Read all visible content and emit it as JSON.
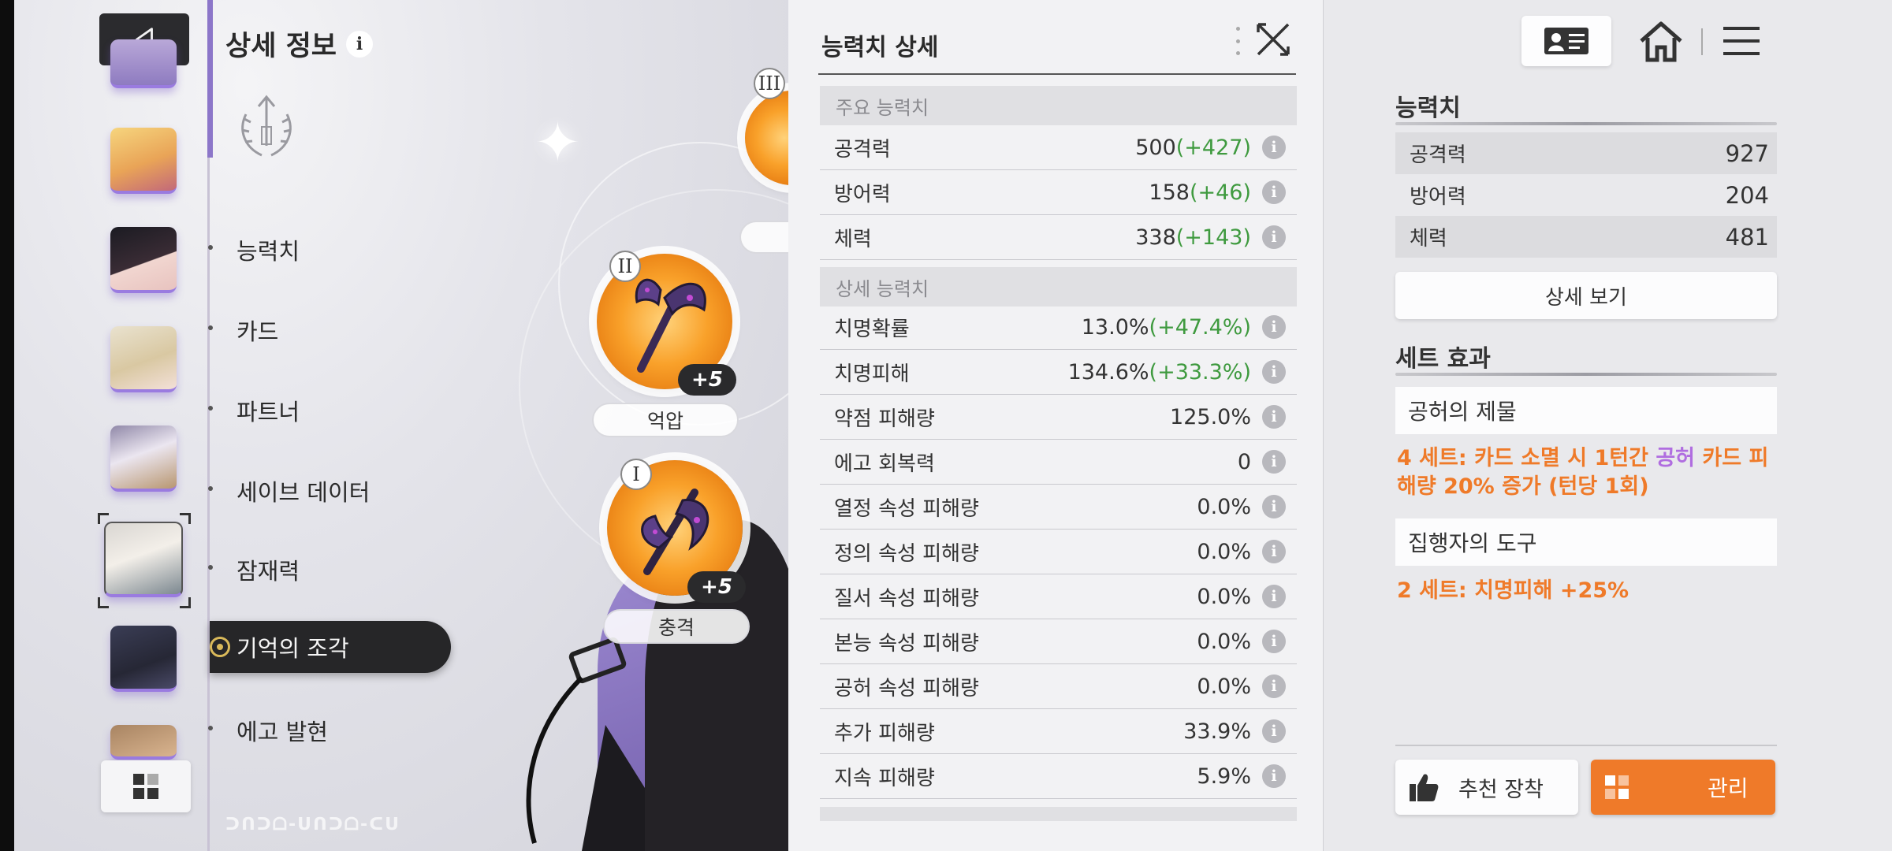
{
  "menu": {
    "title": "상세 정보",
    "info_glyph": "i",
    "items": [
      "능력치",
      "카드",
      "파트너",
      "세이브 데이터",
      "잠재력",
      "기억의 조각",
      "에고 발현"
    ],
    "active_index": 5
  },
  "fragments": [
    {
      "numeral": "III",
      "plus": "",
      "label": ""
    },
    {
      "numeral": "II",
      "plus": "+5",
      "label": "억압"
    },
    {
      "numeral": "I",
      "plus": "+5",
      "label": "충격"
    }
  ],
  "stat_detail": {
    "title": "능력치 상세",
    "main_header": "주요 능력치",
    "main_stats": [
      {
        "name": "공격력",
        "value": "500",
        "bonus": "(+427)"
      },
      {
        "name": "방어력",
        "value": "158",
        "bonus": "(+46)"
      },
      {
        "name": "체력",
        "value": "338",
        "bonus": "(+143)"
      }
    ],
    "sub_header": "상세 능력치",
    "sub_stats": [
      {
        "name": "치명확률",
        "value": "13.0%",
        "bonus": "(+47.4%)"
      },
      {
        "name": "치명피해",
        "value": "134.6%",
        "bonus": "(+33.3%)"
      },
      {
        "name": "약점 피해량",
        "value": "125.0%",
        "bonus": ""
      },
      {
        "name": "에고 회복력",
        "value": "0",
        "bonus": ""
      },
      {
        "name": "열정 속성 피해량",
        "value": "0.0%",
        "bonus": ""
      },
      {
        "name": "정의 속성 피해량",
        "value": "0.0%",
        "bonus": ""
      },
      {
        "name": "질서 속성 피해량",
        "value": "0.0%",
        "bonus": ""
      },
      {
        "name": "본능 속성 피해량",
        "value": "0.0%",
        "bonus": ""
      },
      {
        "name": "공허 속성 피해량",
        "value": "0.0%",
        "bonus": ""
      },
      {
        "name": "추가 피해량",
        "value": "33.9%",
        "bonus": ""
      },
      {
        "name": "지속 피해량",
        "value": "5.9%",
        "bonus": ""
      }
    ],
    "info_glyph": "i"
  },
  "summary": {
    "stats_header": "능력치",
    "stats": [
      {
        "name": "공격력",
        "value": "927"
      },
      {
        "name": "방어력",
        "value": "204"
      },
      {
        "name": "체력",
        "value": "481"
      }
    ],
    "detail_button": "상세 보기",
    "set_header": "세트 효과",
    "sets": [
      {
        "name": "공허의 제물",
        "desc_a": "4 세트: 카드 소멸 시 1턴간 ",
        "desc_highlight": "공허",
        "desc_b": " 카드 피해량 20% 증가 (턴당 1회)"
      },
      {
        "name": "집행자의 도구",
        "desc_a": "2 세트: 치명피해 +25%",
        "desc_highlight": "",
        "desc_b": ""
      }
    ],
    "recommend_button": "추천 장착",
    "manage_button": "관리"
  },
  "colors": {
    "accent_orange": "#ef7a29",
    "bonus_green": "#3f9a3f",
    "highlight_purple": "#b06de0",
    "menu_accent": "#8c76c9"
  },
  "icons": [
    "back-arrow-icon",
    "info-icon",
    "grid-icon",
    "close-icon",
    "profile-card-icon",
    "home-icon",
    "hamburger-menu-icon",
    "thumbs-up-icon"
  ]
}
